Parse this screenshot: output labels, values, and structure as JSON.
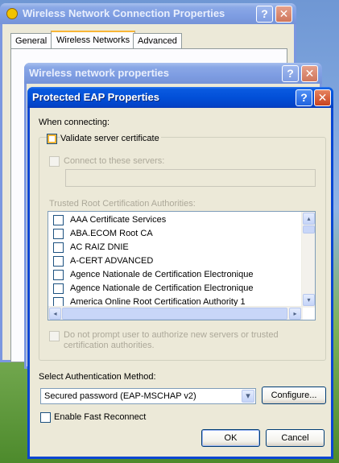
{
  "windows": {
    "back": {
      "title": "Wireless Network Connection Properties",
      "tabs": [
        "General",
        "Wireless Networks",
        "Advanced"
      ]
    },
    "middle": {
      "title": "Wireless network properties"
    },
    "front": {
      "title": "Protected EAP Properties",
      "when_connecting": "When connecting:",
      "validate_cert": "Validate server certificate",
      "connect_servers": "Connect to these servers:",
      "trusted_root": "Trusted Root Certification Authorities:",
      "cert_list": [
        "AAA Certificate Services",
        "ABA.ECOM Root CA",
        "AC RAIZ DNIE",
        "A-CERT ADVANCED",
        "Agence Nationale de Certification Electronique",
        "Agence Nationale de Certification Electronique",
        "America Online Root Certification Authority 1"
      ],
      "no_prompt": "Do not prompt user to authorize new servers or trusted certification authorities.",
      "select_auth": "Select Authentication Method:",
      "auth_method": "Secured password (EAP-MSCHAP v2)",
      "configure": "Configure...",
      "fast_reconnect": "Enable Fast Reconnect",
      "ok": "OK",
      "cancel": "Cancel"
    }
  },
  "icons": {
    "help": "?",
    "close": "✕",
    "dropdown": "▾",
    "scroll_up": "▴",
    "scroll_down": "▾",
    "scroll_left": "◂",
    "scroll_right": "▸"
  },
  "colors": {
    "titlebar": "#0250d8",
    "titlebar_inactive": "#7e9de2",
    "dialog_bg": "#ece9d8",
    "highlight_check": "#f8b636"
  }
}
